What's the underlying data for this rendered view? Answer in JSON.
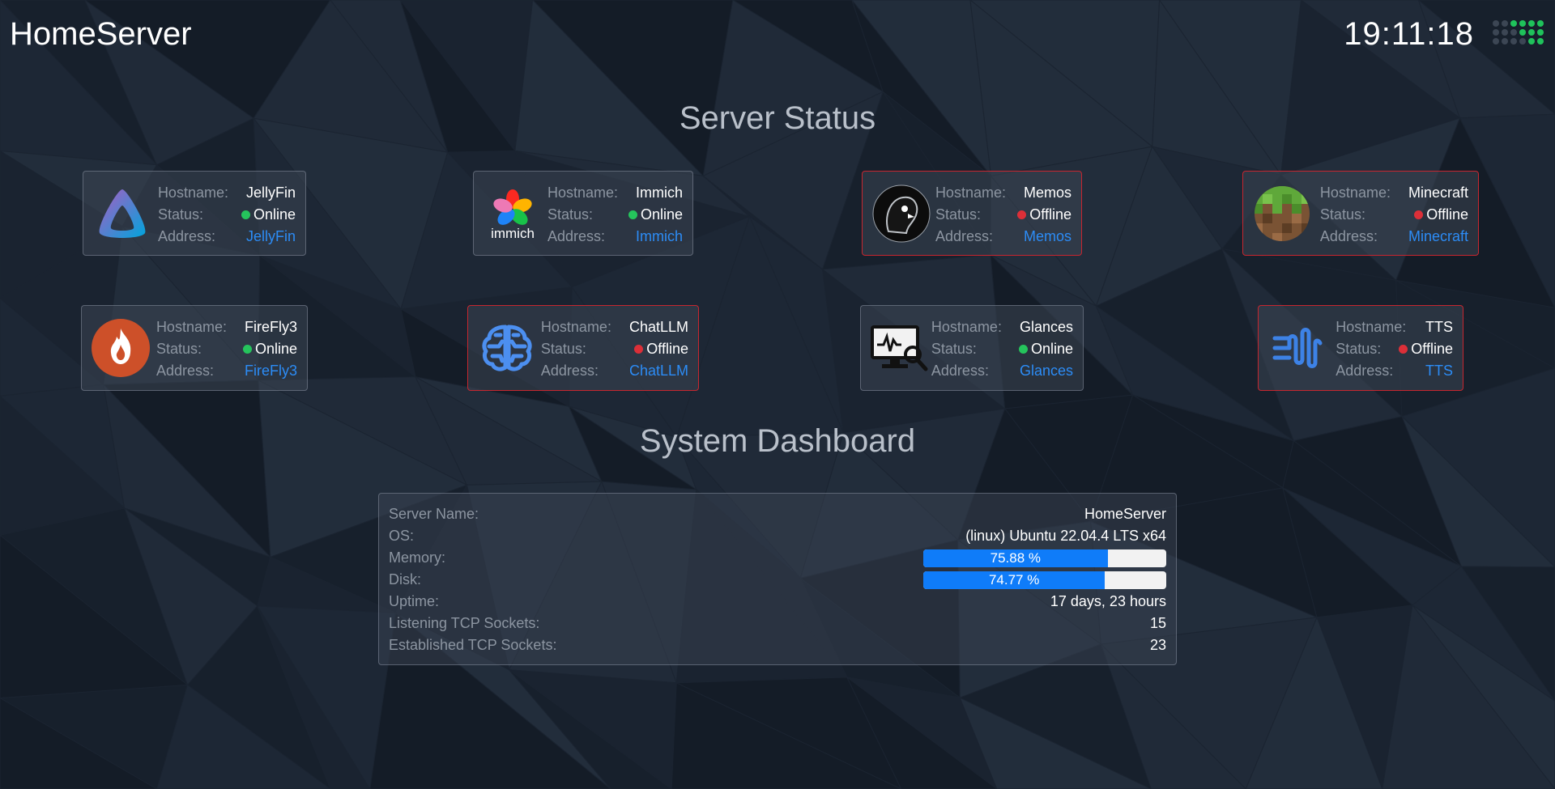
{
  "header": {
    "brand": "HomeServer",
    "clock": "19:11:18",
    "apps_icon": "apps-grid-icon"
  },
  "server_status": {
    "title": "Server Status",
    "labels": {
      "hostname": "Hostname:",
      "status": "Status:",
      "address": "Address:"
    },
    "services": [
      {
        "name": "JellyFin",
        "status": "Online",
        "address": "JellyFin",
        "icon": "jellyfin-icon"
      },
      {
        "name": "Immich",
        "status": "Online",
        "address": "Immich",
        "icon": "immich-icon",
        "logo_text": "immich"
      },
      {
        "name": "Memos",
        "status": "Offline",
        "address": "Memos",
        "icon": "memos-icon"
      },
      {
        "name": "Minecraft",
        "status": "Offline",
        "address": "Minecraft",
        "icon": "minecraft-icon"
      },
      {
        "name": "FireFly3",
        "status": "Online",
        "address": "FireFly3",
        "icon": "firefly-icon"
      },
      {
        "name": "ChatLLM",
        "status": "Offline",
        "address": "ChatLLM",
        "icon": "brain-icon"
      },
      {
        "name": "Glances",
        "status": "Online",
        "address": "Glances",
        "icon": "monitor-icon"
      },
      {
        "name": "TTS",
        "status": "Offline",
        "address": "TTS",
        "icon": "sound-wave-icon"
      }
    ]
  },
  "system_dashboard": {
    "title": "System Dashboard",
    "server_name": {
      "label": "Server Name:",
      "value": "HomeServer"
    },
    "os": {
      "label": "OS:",
      "value": "(linux) Ubuntu 22.04.4 LTS x64"
    },
    "memory": {
      "label": "Memory:",
      "value_text": "75.88 %",
      "percent": 75.88
    },
    "disk": {
      "label": "Disk:",
      "value_text": "74.77 %",
      "percent": 74.77
    },
    "uptime": {
      "label": "Uptime:",
      "value": "17 days, 23 hours"
    },
    "listening": {
      "label": "Listening TCP Sockets:",
      "value": "15"
    },
    "established": {
      "label": "Established TCP Sockets:",
      "value": "23"
    }
  },
  "colors": {
    "online": "#25c45c",
    "offline": "#dc2f38",
    "link": "#2c8cf6",
    "bar_fill": "#0f7cf9"
  }
}
